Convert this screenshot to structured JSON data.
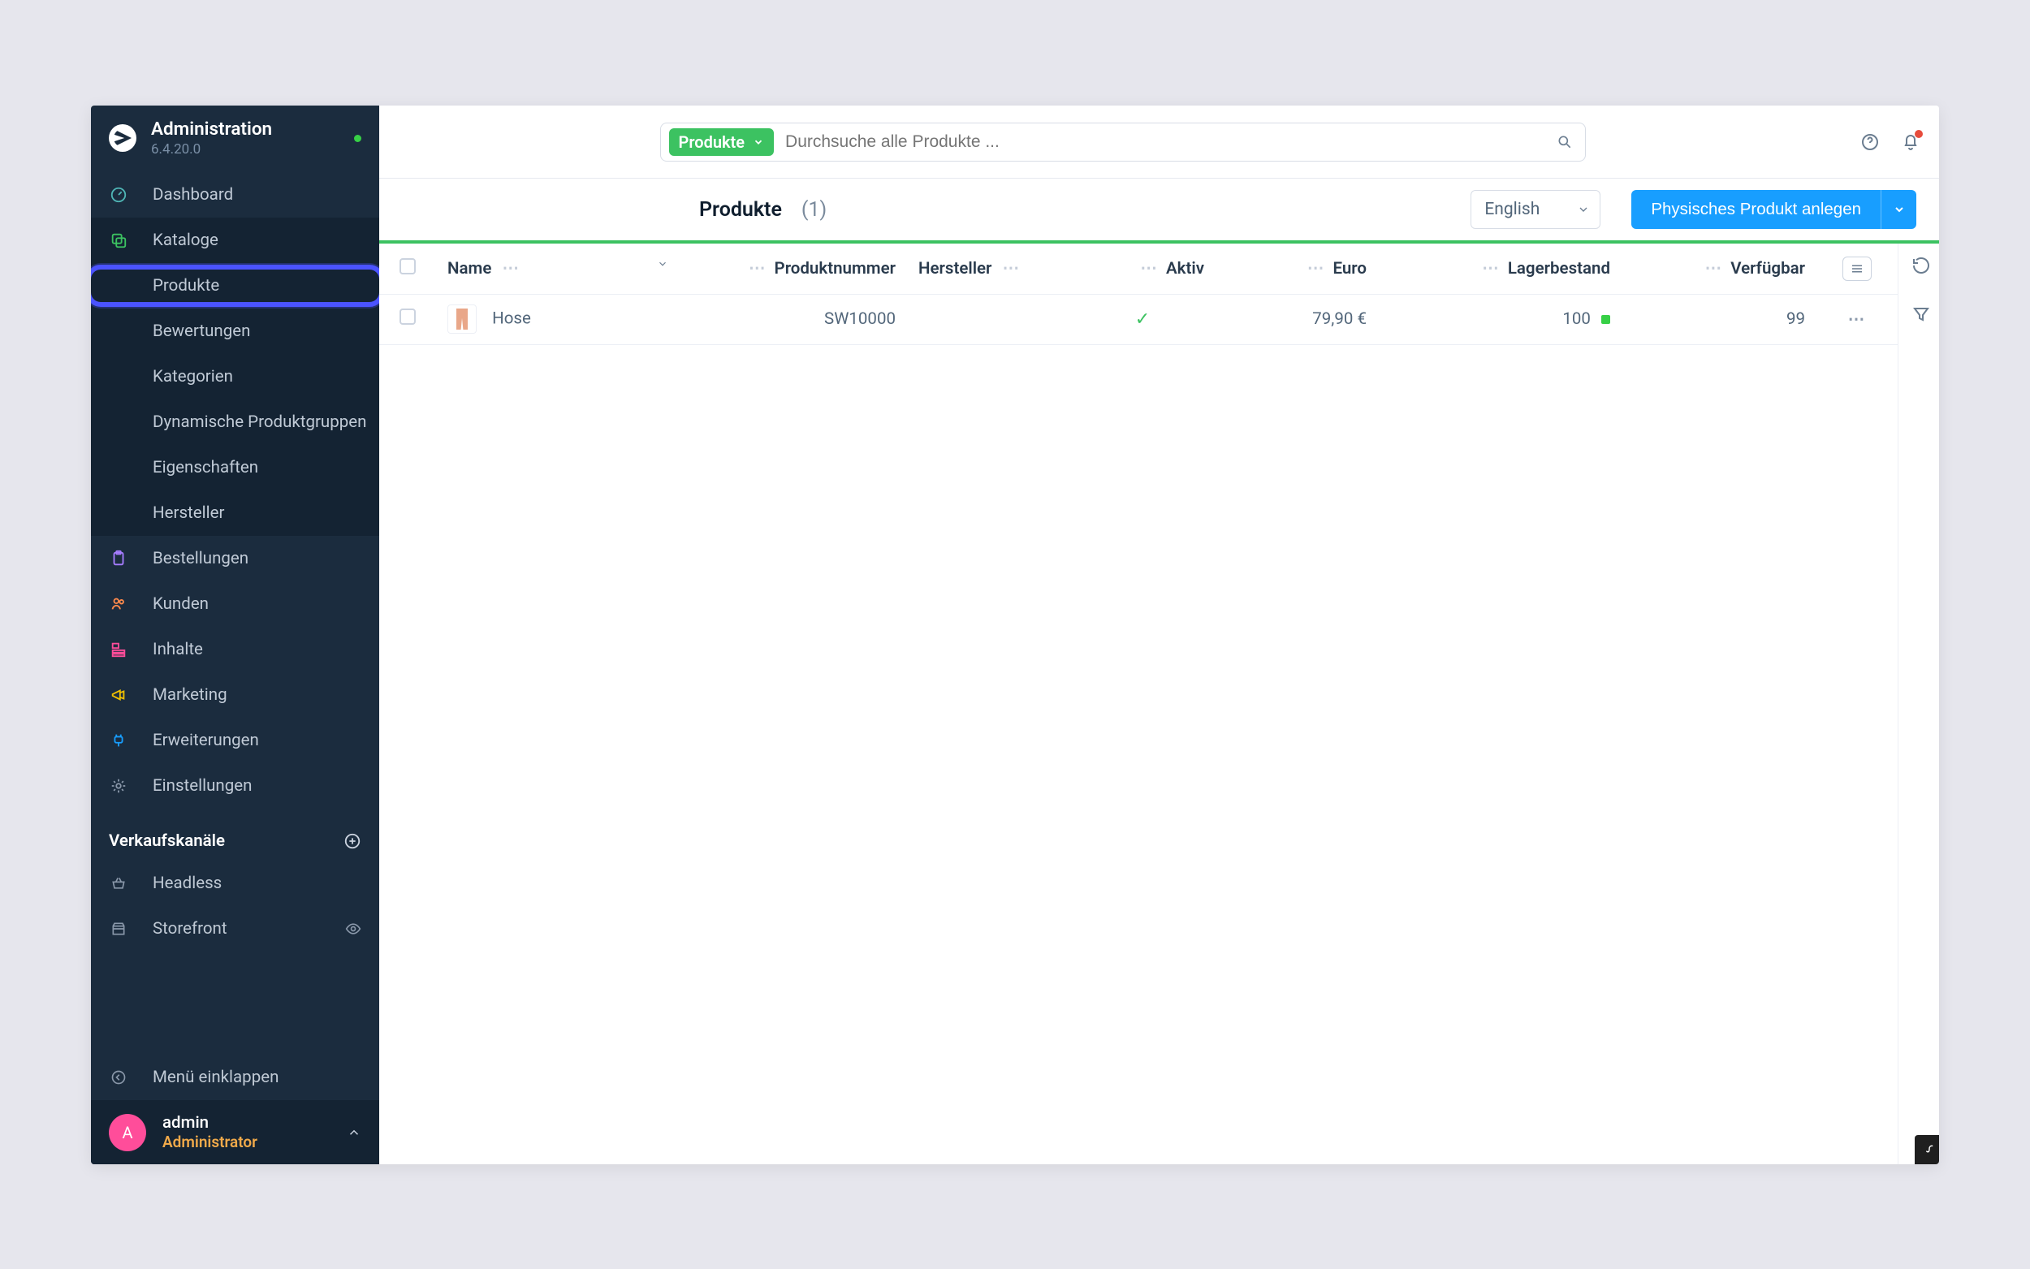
{
  "brand": {
    "title": "Administration",
    "version": "6.4.20.0"
  },
  "nav": {
    "dashboard": "Dashboard",
    "catalogs": "Kataloge",
    "orders": "Bestellungen",
    "customers": "Kunden",
    "content": "Inhalte",
    "marketing": "Marketing",
    "extensions": "Erweiterungen",
    "settings": "Einstellungen"
  },
  "catalogs_sub": {
    "products": "Produkte",
    "reviews": "Bewertungen",
    "categories": "Kategorien",
    "dynamic_groups": "Dynamische Produktgruppen",
    "properties": "Eigenschaften",
    "manufacturers": "Hersteller"
  },
  "channels": {
    "heading": "Verkaufskanäle",
    "headless": "Headless",
    "storefront": "Storefront"
  },
  "collapse_label": "Menü einklappen",
  "user": {
    "initial": "A",
    "name": "admin",
    "role": "Administrator"
  },
  "search": {
    "type_label": "Produkte",
    "placeholder": "Durchsuche alle Produkte ..."
  },
  "page": {
    "title": "Produkte",
    "count": "(1)"
  },
  "language": "English",
  "actions": {
    "create_product": "Physisches Produkt anlegen"
  },
  "columns": {
    "name": "Name",
    "product_number": "Produktnummer",
    "manufacturer": "Hersteller",
    "active": "Aktiv",
    "price": "Euro",
    "stock": "Lagerbestand",
    "available": "Verfügbar"
  },
  "rows": [
    {
      "name": "Hose",
      "product_number": "SW10000",
      "manufacturer": "",
      "active": true,
      "price": "79,90 €",
      "stock": "100",
      "available": "99"
    }
  ],
  "colors": {
    "accent_green": "#3cc261",
    "primary_blue": "#189eff",
    "highlight": "#4b53ff"
  }
}
